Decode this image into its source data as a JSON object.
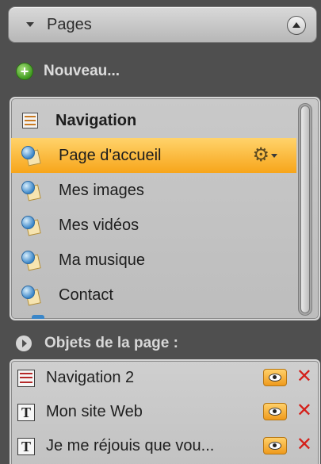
{
  "pages_section": {
    "title": "Pages",
    "new_label": "Nouveau...",
    "items": [
      {
        "label": "Navigation",
        "icon": "navigation-icon",
        "bold": true
      },
      {
        "label": "Page d'accueil",
        "icon": "page-globe-icon",
        "selected": true
      },
      {
        "label": "Mes images",
        "icon": "page-globe-icon"
      },
      {
        "label": "Mes vidéos",
        "icon": "page-globe-icon"
      },
      {
        "label": "Ma musique",
        "icon": "page-globe-icon"
      },
      {
        "label": "Contact",
        "icon": "page-globe-icon"
      }
    ],
    "selected_accent": "#f7a51a"
  },
  "objects_section": {
    "title": "Objets de la page :",
    "items": [
      {
        "label": "Navigation 2",
        "icon": "navigation-object-icon"
      },
      {
        "label": "Mon site Web",
        "icon": "text-object-icon"
      },
      {
        "label": "Je me réjouis que vou...",
        "icon": "text-object-icon"
      }
    ],
    "delete_color": "#d4201a"
  }
}
